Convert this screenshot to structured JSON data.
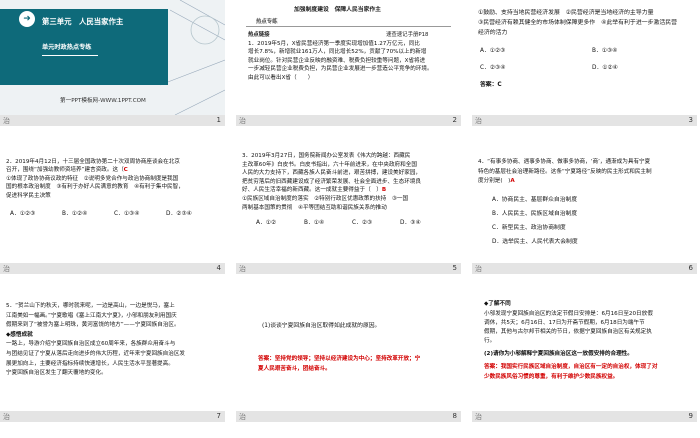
{
  "footer_label": "治",
  "slides": [
    {
      "num": "1",
      "unit_title": "第三单元　人民当家作主",
      "subtitle": "单元时政热点专练",
      "brand": "第一PPT模板网-WWW.1PPT.COM",
      "icon": "arrow-right-icon"
    },
    {
      "num": "2",
      "header": "加强制度建设　保障人民当家作主",
      "section": "热点专练",
      "q_label": "热点链接",
      "q_ref": "速查速记手册P18",
      "lines": [
        "1．2019年5月，X省民营经济第一季度实现增加值1.27万亿元，同比",
        "增长7.8%，新增就业161万人，同比增长52%，贡献了70%以上的新增",
        "就业岗位。针对民营企业反映的融资难、税费负担较重等问题，X省将进",
        "一步减轻民营企业税费负担，为民营企业发展进一步营造公平竞争的环境。",
        "由此可以看出X省（　　）"
      ]
    },
    {
      "num": "3",
      "lines": [
        "①鼓励、支持当地民营经济发展　②民营经济是当地经济的主导力量",
        "③民营经济有赖其健全的市场体制保障更多作　④此举有利于进一步激活民营",
        "经济的活力"
      ],
      "options": [
        "A．①②③",
        "B．①③④",
        "C．②③④",
        "D．①②④"
      ],
      "answer": "答案：C"
    },
    {
      "num": "4",
      "lines": [
        "2．2019年4月12日，十三届全国政协第二十次双周协商座谈会在北京",
        "召开，围绕“加强幼教师资培养”建言资政。这（",
        "①体现了政协协商议政的特征　②说明多党合作与政治协商制度是我国",
        "国的根本政治制度　③有利于办好人民满意的教育　④有利于集中民智，",
        "促进科学民主决策"
      ],
      "answer_mark": "C",
      "options": [
        "A．①②③",
        "B．①②④",
        "C．①③④",
        "D．②③④"
      ]
    },
    {
      "num": "5",
      "lines": [
        "3．2019年3月27日，国务院新闻办公室发表《伟大的跨越：西藏民",
        "主改革60年》白皮书。白皮书指出，六十年前进来，在中央政府和全国",
        "人民的大力支持下，西藏各族人民奋斗前进，艰苦拼搏，建设美好家园，",
        "把贫穷落后的旧西藏建设成了经济繁荣发展、社会全面进步、生态环境良",
        "好、人民生活幸福的新西藏。这一成就主要得益于（　）",
        "①民族区域自治制度的落实　②特别行政区优惠政策的扶持　③一国",
        "两制基本国策的贯彻　④平等团结互助和谐民族关系的推动"
      ],
      "answer_mark": "B",
      "options": [
        "A．①②",
        "B．①④",
        "C．②③",
        "D．③④"
      ]
    },
    {
      "num": "6",
      "lines": [
        "4．“有事多协商、遇事多协商、做事多协商，‘商’，通渐成为具有宁夏",
        "特色的基层社会治理新路径。这条“宁夏路径”反映的民主形式和民主制",
        "度分别是(　)"
      ],
      "answer_mark": "A",
      "options": [
        "A．协商民主、基层群众自治制度",
        "B．人民民主、民族区域自治制度",
        "C．新型民主、政治协商制度",
        "D．选举民主、人民代表大会制度"
      ]
    },
    {
      "num": "7",
      "lines": [
        "5．“贺兰山下的秋天，哪时就来呢，一边是高山，一边是悦马，塞上",
        "江南美如一幅画。”宁夏歌唱《塞上江南大宁夏》，小邬和朋友利用国庆",
        "假期来到了“被誉为塞上明珠，黄河富饶的地方”——宁夏回族自治区。",
        "◆感悟成就",
        "一路上，导游介绍宁夏回族自治区成立60周年来，各族群众用奋斗与",
        "与团结见证了宁夏从落后走向进步的伟大历程，近年来宁夏回族自治区发",
        "展更加向上，主要经济指标持续快速增长，人民生活水平显著提高。",
        "宁夏回族自治区发生了翻天覆地的变化。"
      ]
    },
    {
      "num": "8",
      "lines": [
        "(1)谈谈宁夏回族自治区取得如此成就的原因。"
      ],
      "answer_lines": [
        "答案：坚持党的领导；坚持以经济建设为中心；坚持改革开放；宁",
        "夏人民艰苦奋斗，团结奋斗。"
      ]
    },
    {
      "num": "9",
      "heading": "◆了解不同",
      "lines": [
        "小邬发现宁夏回族自治区的法定节假日安排是：6月16日至20日放假",
        "调休，共5天；6月16日、17日为开斋节假期，6月18日为端午节",
        "假期，其他与古尔邦节相关的节日，依据宁夏回族自治区有关规定执",
        "行。"
      ],
      "question": "(2)请你为小邬解释宁夏回族自治区这一放假安排的合理性。",
      "answer_lines": [
        "答案：我国实行民族区域自治制度，自治区有一定的自治权，体现了对",
        "少数民族风俗习惯的尊重，有利于维护少数民族权益。"
      ]
    }
  ]
}
